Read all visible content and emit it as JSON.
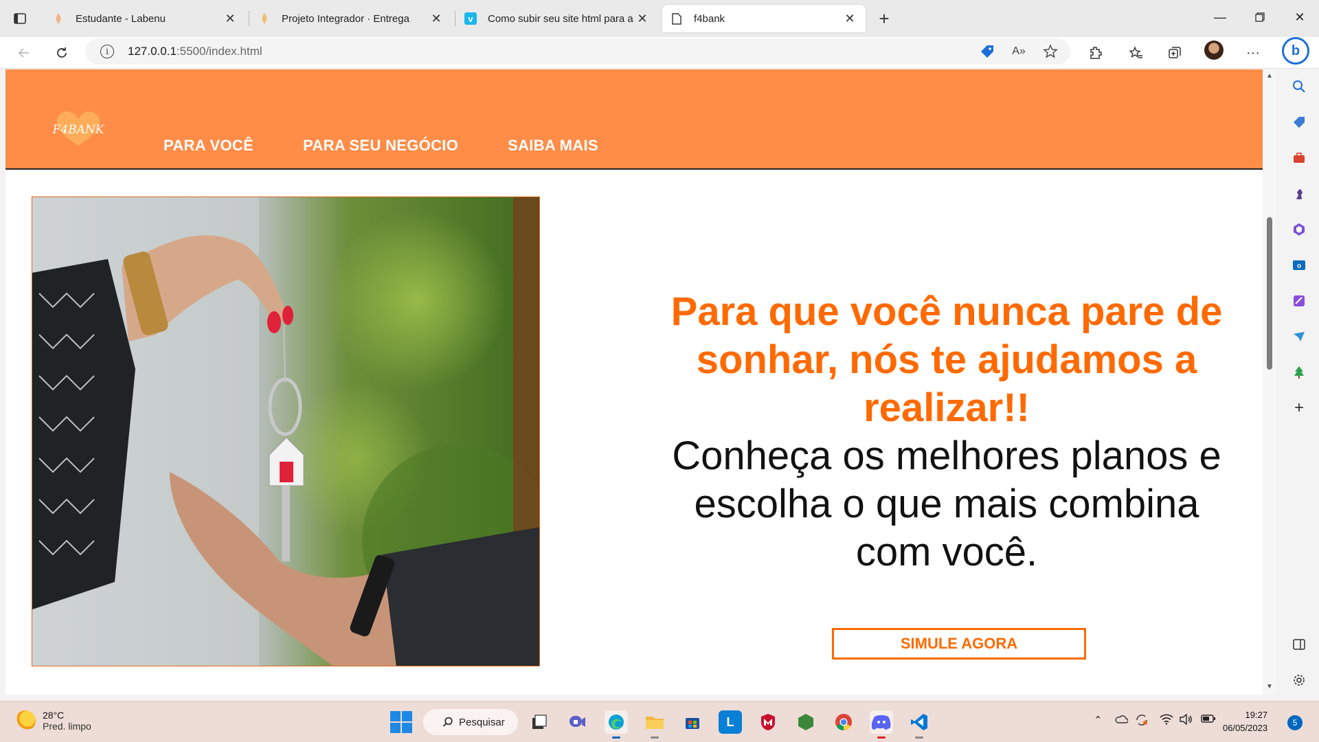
{
  "browser": {
    "tabs": [
      {
        "title": "Estudante - Labenu",
        "active": false
      },
      {
        "title": "Projeto Integrador · Entrega",
        "active": false
      },
      {
        "title": "Como subir seu site html para a",
        "active": false
      },
      {
        "title": "f4bank",
        "active": true
      }
    ],
    "address": {
      "host": "127.0.0.1",
      "path": ":5500/index.html"
    }
  },
  "site": {
    "logo_text": "F4BANK",
    "nav": [
      "PARA VOCÊ",
      "PARA SEU NEGÓCIO",
      "SAIBA MAIS"
    ],
    "hero_title": "Para que você nunca pare de sonhar, nós te ajudamos a realizar!!",
    "hero_subtitle": "Conheça os melhores planos e escolha o que mais combina com você.",
    "cta": "SIMULE AGORA",
    "colors": {
      "brand_orange": "#ff8c47",
      "accent_orange": "#ff6a00"
    }
  },
  "taskbar": {
    "weather_temp": "28°C",
    "weather_desc": "Pred. limpo",
    "search_label": "Pesquisar",
    "time": "19:27",
    "date": "06/05/2023",
    "notifications": "5"
  }
}
